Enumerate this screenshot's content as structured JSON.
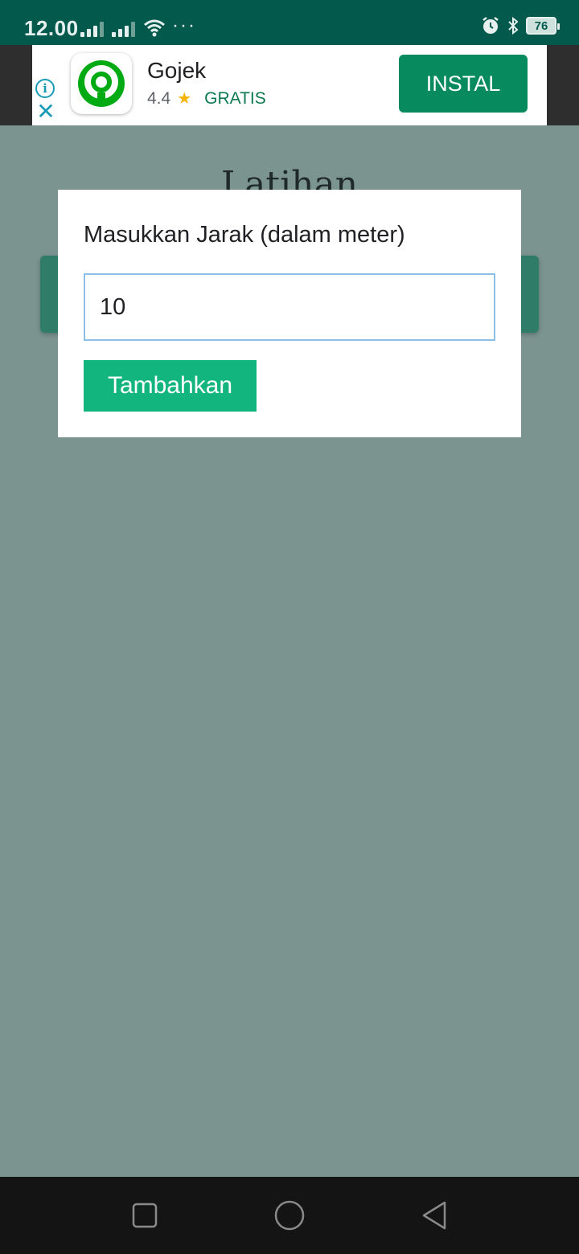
{
  "status_bar": {
    "time": "12.00",
    "dots": "···",
    "battery": "76"
  },
  "ad": {
    "app_name": "Gojek",
    "rating": "4.4",
    "star": "★",
    "price": "GRATIS",
    "install_label": "INSTAL",
    "info_icon": "i",
    "close_icon": "✕",
    "brand_color": "#078a5e"
  },
  "page": {
    "title": "Latihan"
  },
  "dialog": {
    "label": "Masukkan Jarak (dalam meter)",
    "input_value": "10",
    "button_label": "Tambahkan"
  },
  "nav": {
    "recents": "square-icon",
    "home": "circle-icon",
    "back": "triangle-back-icon"
  }
}
